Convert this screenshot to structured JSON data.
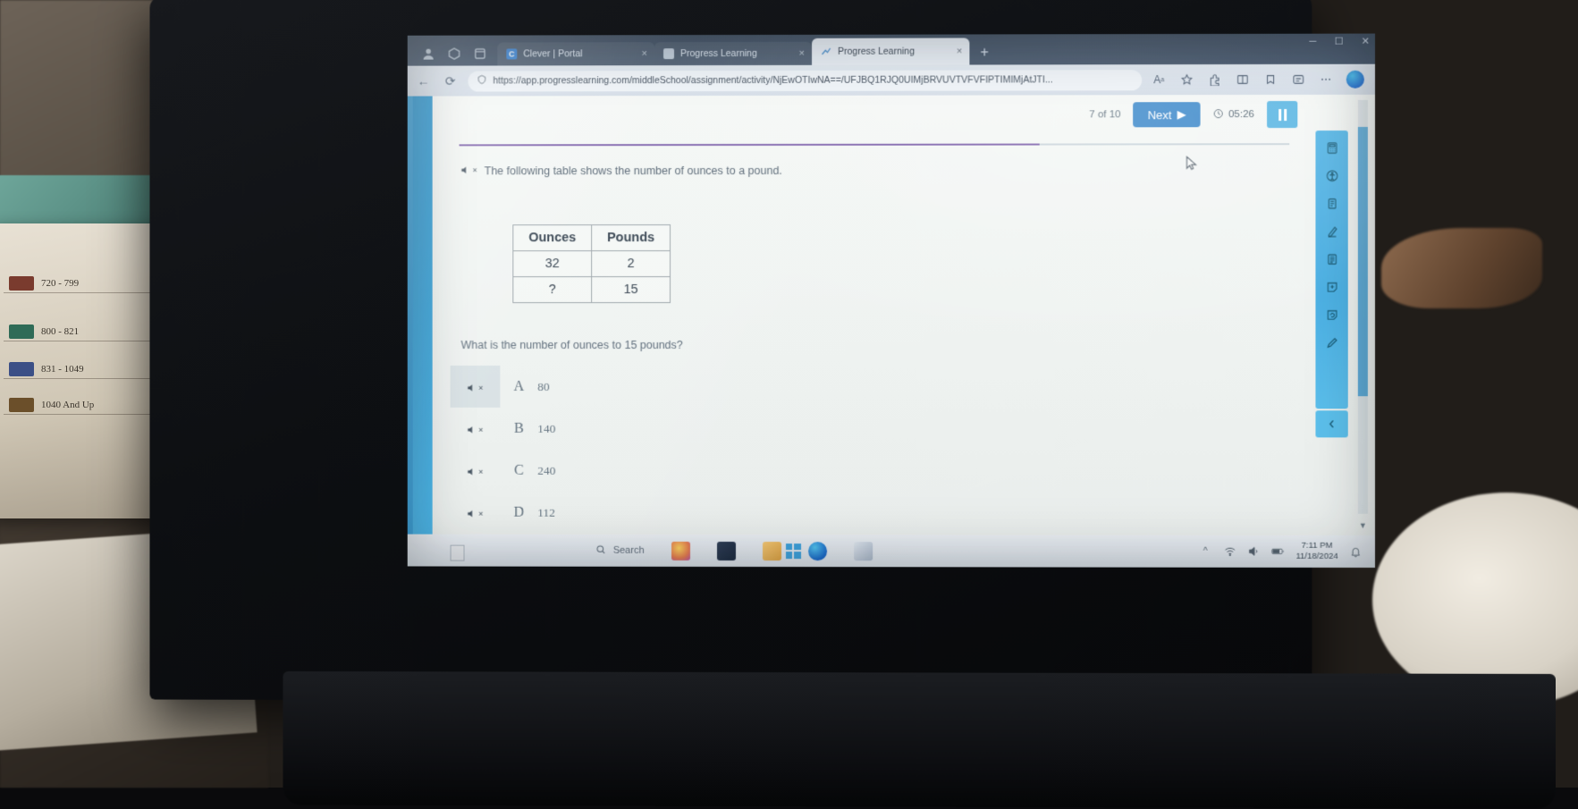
{
  "browser": {
    "tabs": [
      {
        "title": "Clever | Portal",
        "favicon": "clever-icon",
        "active": false,
        "close": "×"
      },
      {
        "title": "Progress Learning",
        "favicon": "page-icon",
        "active": false,
        "close": "×"
      },
      {
        "title": "Progress Learning",
        "favicon": "progress-learning-icon",
        "active": true,
        "close": "×"
      }
    ],
    "new_tab_label": "+",
    "window_controls": {
      "minimize": "─",
      "maximize": "☐",
      "close": "✕"
    },
    "nav": {
      "back": "←",
      "refresh": "⟳",
      "url": "https://app.progresslearning.com/middleScool/assignment/activity/NjEwOTIwNA==/UFJBQ1RJQ0UIMjBRVUVTVFVFIPTIMlMjAtJTI...",
      "url_display": "https://app.progresslearning.com/middleSchool/assignment/activity/NjEwOTIwNA==/UFJBQ1RJQ0UIMjBRVUVTVFVFIPTIMIMjAtJTI...",
      "security_icon": "shield-icon",
      "right_icons": [
        "read-aloud-icon",
        "favorite-star-icon",
        "extensions-icon",
        "split-screen-icon",
        "collections-icon",
        "browser-essentials-icon",
        "copilot-icon",
        "settings-more-icon"
      ]
    }
  },
  "activity": {
    "question_counter": "7 of 10",
    "next_label": "Next",
    "next_arrow": "▶",
    "timer": "05:26",
    "timer_icon": "clock-icon",
    "pause_label": "pause-button",
    "progress_percent": 70,
    "prompt": "The following table shows the number of ounces to a pound.",
    "question": "What is the number of ounces to 15 pounds?",
    "speaker_icon": "speaker-muted-icon",
    "table": {
      "headers": [
        "Ounces",
        "Pounds"
      ],
      "rows": [
        [
          "32",
          "2"
        ],
        [
          "?",
          "15"
        ]
      ]
    },
    "answers": [
      {
        "letter": "A",
        "value": "80",
        "highlighted": true
      },
      {
        "letter": "B",
        "value": "140",
        "highlighted": false
      },
      {
        "letter": "C",
        "value": "240",
        "highlighted": false
      },
      {
        "letter": "D",
        "value": "112",
        "highlighted": false
      }
    ],
    "tools": [
      "calculator-icon",
      "accessibility-icon",
      "notepad-icon",
      "highlighter-icon",
      "reference-sheet-icon",
      "sticky-note-add-icon",
      "sticky-note-refresh-icon",
      "pencil-icon"
    ],
    "collapse_icon": "chevron-left-icon"
  },
  "taskbar": {
    "start_label": "start-button",
    "search_placeholder": "Search",
    "search_icon": "search-icon",
    "apps": [
      "photos-app-icon",
      "file-explorer-dark-icon",
      "folder-icon",
      "edge-icon",
      "calculator-icon"
    ],
    "tray": [
      "chevron-up-icon",
      "wifi-icon",
      "volume-icon",
      "battery-icon"
    ],
    "time": "7:11 PM",
    "date": "11/18/2024",
    "notification_icon": "bell-icon"
  },
  "desk": {
    "card_rows": [
      {
        "label": "720 - 799",
        "color": "#7a3b2e"
      },
      {
        "label": "800 - 821",
        "color": "#2f6b57"
      },
      {
        "label": "831 - 1049",
        "color": "#3b4f86"
      },
      {
        "label": "1040 And Up",
        "color": "#6b4f2a"
      }
    ]
  },
  "colors": {
    "accent_blue": "#3b87c9",
    "rail_blue": "#4fb3e6",
    "progress_purple": "#7b5ea8"
  }
}
